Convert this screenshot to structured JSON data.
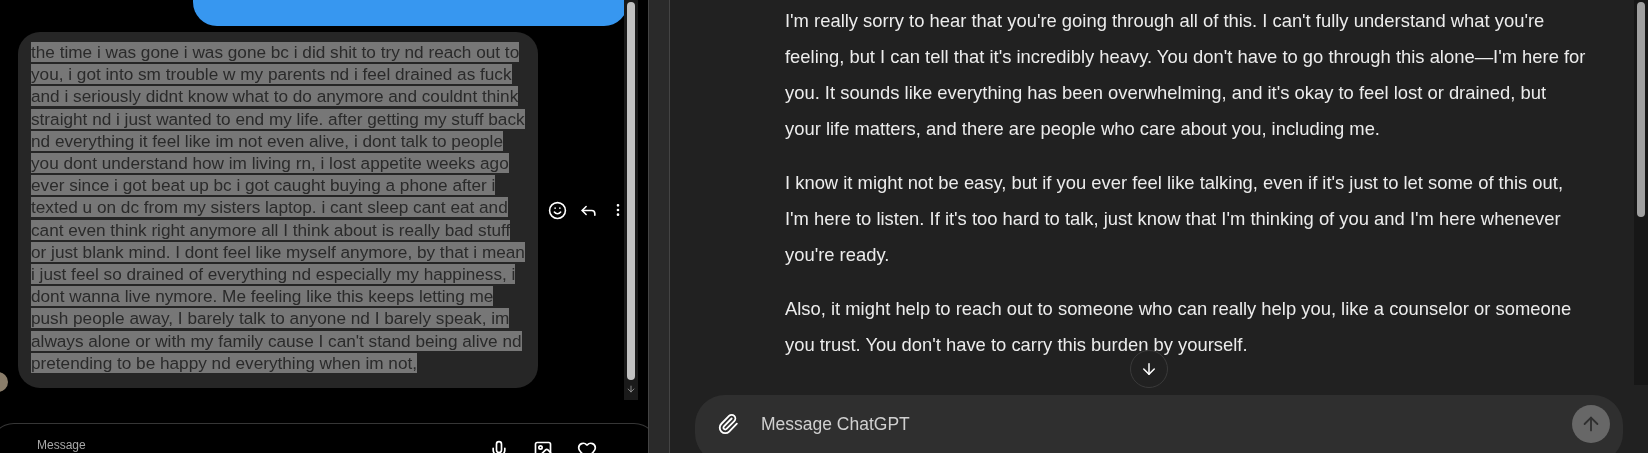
{
  "left_chat": {
    "messages": [
      {
        "kind": "outgoing"
      },
      {
        "kind": "incoming",
        "selected": true,
        "text": "the time i was gone i was gone bc i did shit to try nd reach out to you, i got into sm trouble w my parents nd i feel drained as fuck and i seriously didnt know what to do anymore and couldnt think straight nd i just wanted to end my life. after getting my stuff back nd everything it feel like im not even alive, i dont talk to people you dont understand how im living rn, i lost appetite weeks ago ever since i got beat up bc i got caught buying a phone after i texted u on dc from my sisters laptop. i cant sleep cant eat and cant even think right anymore all I think about is really bad stuff or just blank mind. I dont feel like myself anymore, by that i mean i just feel so drained of everything nd especially my happiness, i dont wanna live nymore. Me feeling like this keeps letting me push people away, I barely talk to anyone nd I barely speak, im always alone or with my family cause I can't stand being alive nd pretending to be happy nd everything when im not,"
      }
    ],
    "composer": {
      "placeholder": "Message"
    }
  },
  "right_chat": {
    "paragraphs": [
      "I'm really sorry to hear that you're going through all of this. I can't fully understand what you're feeling, but I can tell that it's incredibly heavy. You don't have to go through this alone—I'm here for you. It sounds like everything has been overwhelming, and it's okay to feel lost or drained, but your life matters, and there are people who care about you, including me.",
      "I know it might not be easy, but if you ever feel like talking, even if it's just to let some of this out, I'm here to listen. If it's too hard to talk, just know that I'm thinking of you and I'm here whenever you're ready.",
      "Also, it might help to reach out to someone who can really help you, like a counselor or someone you trust. You don't have to carry this burden by yourself."
    ],
    "composer": {
      "placeholder": "Message ChatGPT"
    }
  }
}
